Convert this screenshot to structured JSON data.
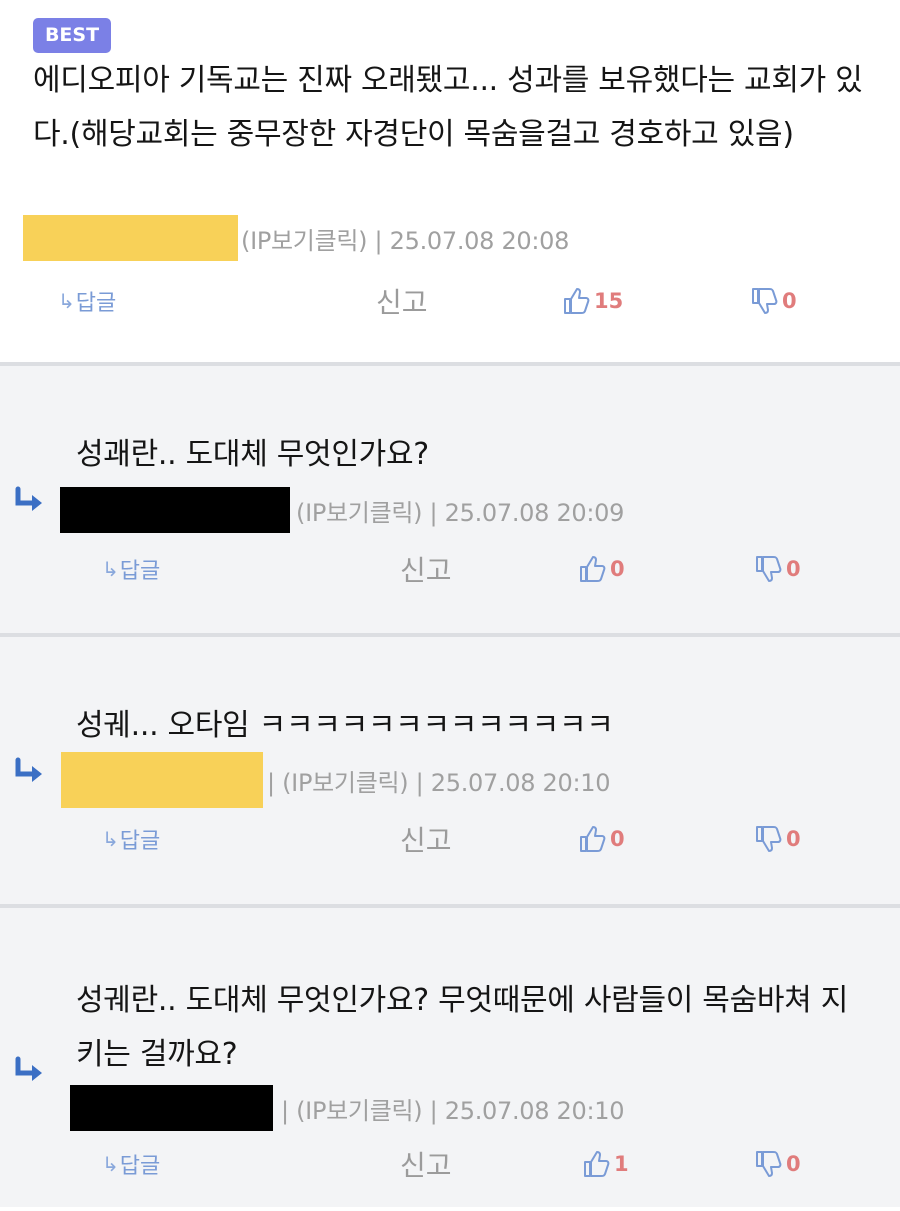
{
  "labels": {
    "best_badge": "BEST",
    "reply_button": "답글",
    "report_button": "신고"
  },
  "comments": [
    {
      "text": "에디오피아 기독교는 진짜 오래됐고... 성과를 보유했다는 교회가 있다.(해당교회는 중무장한 자경단이 목숨을걸고 경호하고 있음)",
      "meta": "(IP보기클릭) | 25.07.08 20:08",
      "likes": "15",
      "dislikes": "0"
    },
    {
      "text": "성괘란.. 도대체 무엇인가요?",
      "meta": "(IP보기클릭) | 25.07.08 20:09",
      "likes": "0",
      "dislikes": "0"
    },
    {
      "text": "성궤... 오타임 ㅋㅋㅋㅋㅋㅋㅋㅋㅋㅋㅋㅋㅋ",
      "meta": "| (IP보기클릭) | 25.07.08 20:10",
      "likes": "0",
      "dislikes": "0"
    },
    {
      "text": "성궤란.. 도대체 무엇인가요? 무엇때문에 사람들이 목숨바쳐 지키는 걸까요?",
      "meta": "| (IP보기클릭) | 25.07.08 20:10",
      "likes": "1",
      "dislikes": "0"
    }
  ],
  "colors": {
    "badge": "#7b80e6",
    "mask_yellow": "#f8d158",
    "mask_black": "#000000",
    "reply_link": "#7a9bd6",
    "thumb_icon": "#7a9bd6",
    "vote_count": "#e07c7c",
    "reply_background": "#f3f4f6",
    "reply_arrow": "#3b6fc4"
  },
  "icons": [
    "reply-arrow-icon",
    "thumbs-up-icon",
    "thumbs-down-icon",
    "indent-arrow-icon"
  ]
}
